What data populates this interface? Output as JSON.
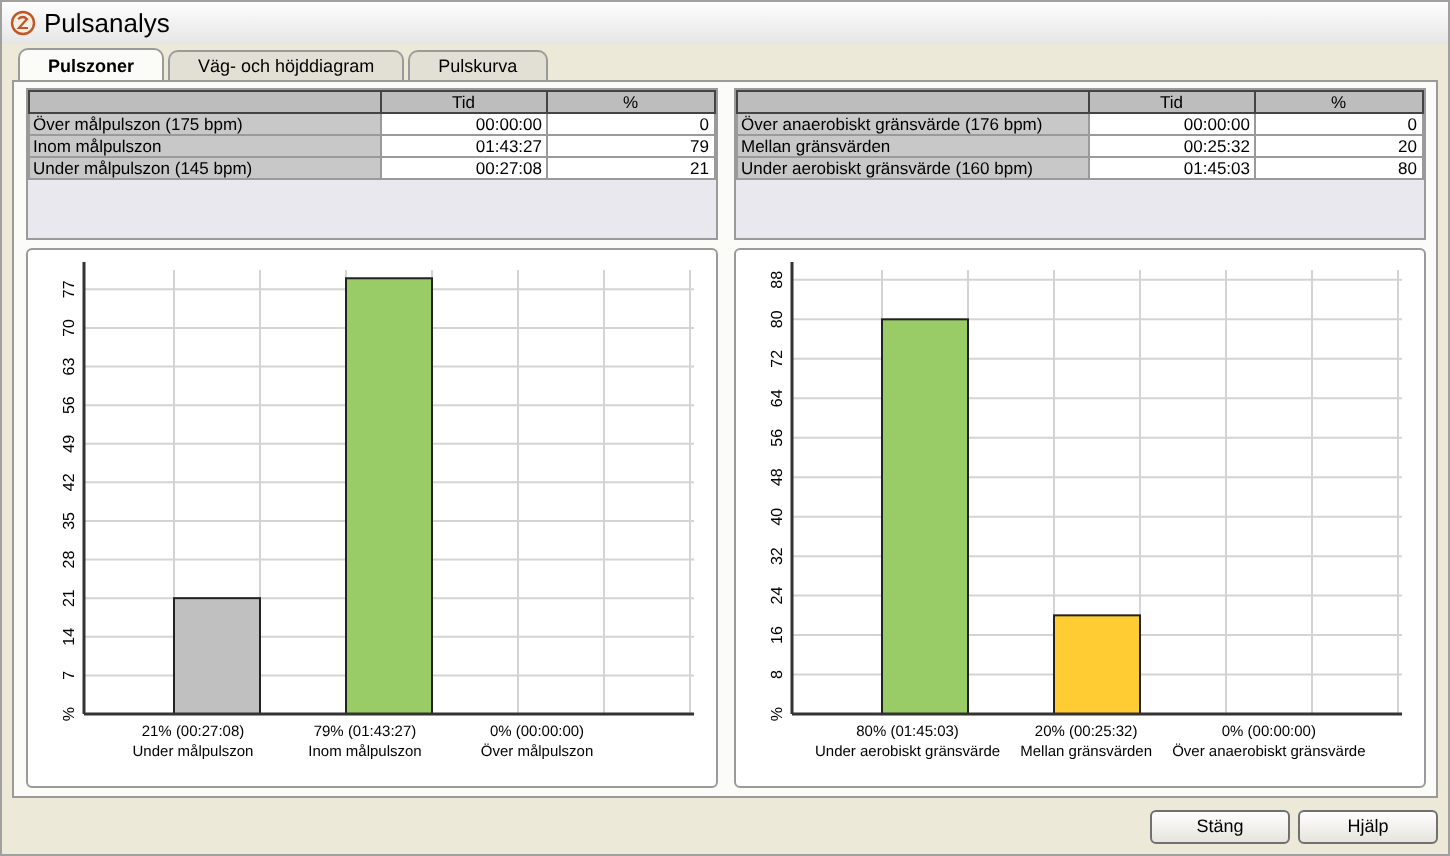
{
  "window": {
    "title": "Pulsanalys"
  },
  "tabs": [
    {
      "label": "Pulszoner",
      "selected": true
    },
    {
      "label": "Väg- och höjddiagram",
      "selected": false
    },
    {
      "label": "Pulskurva",
      "selected": false
    }
  ],
  "panels": [
    {
      "table": {
        "columns": [
          "Tid",
          "%"
        ],
        "rows": [
          {
            "label": "Över målpulszon (175 bpm)",
            "tid": "00:00:00",
            "percent": "0"
          },
          {
            "label": "Inom målpulszon",
            "tid": "01:43:27",
            "percent": "79"
          },
          {
            "label": "Under målpulszon (145 bpm)",
            "tid": "00:27:08",
            "percent": "21"
          }
        ]
      },
      "chart_data": {
        "type": "bar",
        "categories": [
          "Under målpulszon",
          "Inom målpulszon",
          "Över målpulszon"
        ],
        "value_labels": [
          "21% (00:27:08)",
          "79% (01:43:27)",
          "0% (00:00:00)"
        ],
        "series": [
          {
            "colors": [
              "#c0c0c0",
              "#99cc66",
              null
            ],
            "values": [
              21,
              79,
              0
            ]
          }
        ],
        "grid": true,
        "ylim": [
          0,
          80.5
        ],
        "yticks": [
          {
            "value": 0,
            "label": "%"
          },
          7,
          14,
          21,
          28,
          35,
          42,
          49,
          56,
          63,
          70,
          77
        ]
      }
    },
    {
      "table": {
        "columns": [
          "Tid",
          "%"
        ],
        "rows": [
          {
            "label": "Över anaerobiskt gränsvärde (176 bpm)",
            "tid": "00:00:00",
            "percent": "0"
          },
          {
            "label": "Mellan gränsvärden",
            "tid": "00:25:32",
            "percent": "20"
          },
          {
            "label": "Under aerobiskt gränsvärde (160 bpm)",
            "tid": "01:45:03",
            "percent": "80"
          }
        ]
      },
      "chart_data": {
        "type": "bar",
        "categories": [
          "Under aerobiskt gränsvärde",
          "Mellan gränsvärden",
          "Över anaerobiskt gränsvärde"
        ],
        "value_labels": [
          "80% (01:45:03)",
          "20% (00:25:32)",
          "0% (00:00:00)"
        ],
        "series": [
          {
            "colors": [
              "#99cc66",
              "#ffcc33",
              null
            ],
            "values": [
              80,
              20,
              0
            ]
          }
        ],
        "grid": true,
        "ylim": [
          0,
          90
        ],
        "yticks": [
          {
            "value": 0,
            "label": "%"
          },
          8,
          16,
          24,
          32,
          40,
          48,
          56,
          64,
          72,
          80,
          88
        ]
      }
    }
  ],
  "buttons": [
    "Stäng",
    "Hjälp"
  ]
}
